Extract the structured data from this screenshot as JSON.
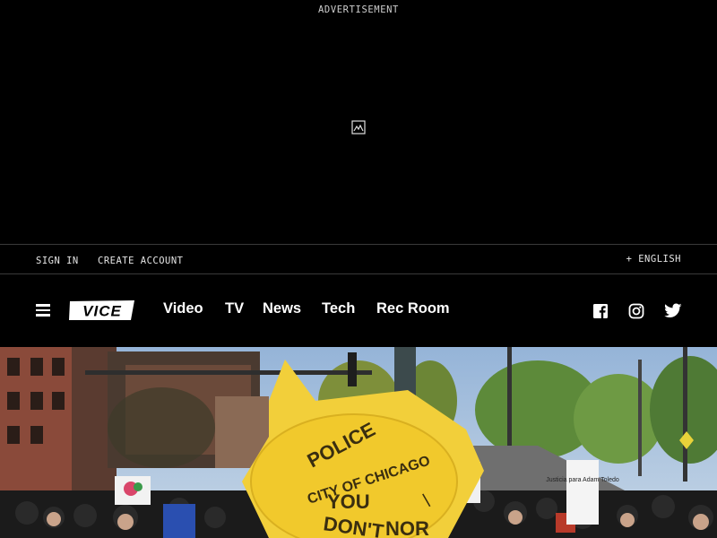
{
  "ad": {
    "label": "ADVERTISEMENT",
    "icon": "broken-image-icon"
  },
  "account_bar": {
    "sign_in": "SIGN IN",
    "create_account": "CREATE ACCOUNT",
    "language": "+ ENGLISH"
  },
  "nav": {
    "menu_icon": "hamburger-menu-icon",
    "logo_text": "VICE",
    "links": [
      "Video",
      "TV",
      "News",
      "Tech",
      "Rec Room"
    ],
    "social": [
      "facebook-icon",
      "instagram-icon",
      "twitter-icon"
    ]
  },
  "hero": {
    "sign_lines": [
      "POLICE",
      "CITY OF CHICAGO",
      "YOU",
      "DON'T",
      "NOR"
    ],
    "placard_text": "Justicia para Adam Toledo",
    "colors": {
      "sky": "#a9c2dd",
      "sign_yellow": "#f2cf3a",
      "sign_ink": "#3a2e10"
    }
  }
}
